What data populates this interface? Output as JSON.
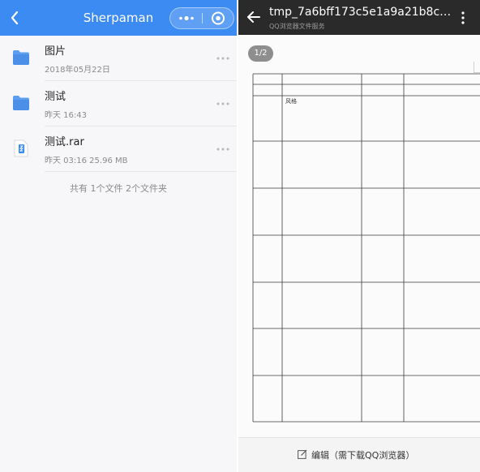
{
  "mini_program": {
    "title": "Sherpaman",
    "header_color": "#3c8bf2",
    "back_icon": "chevron-left-icon",
    "capsule": {
      "more_icon": "more-dots-icon",
      "close_icon": "target-close-icon"
    },
    "files": [
      {
        "name": "图片",
        "meta": "2018年05月22日",
        "icon": "folder-icon"
      },
      {
        "name": "测试",
        "meta": "昨天 16:43",
        "icon": "folder-icon"
      },
      {
        "name": "测试.rar",
        "meta": "昨天 03:16 25.96 MB",
        "icon": "archive-file-icon"
      }
    ],
    "summary": "共有 1个文件 2个文件夹"
  },
  "browser": {
    "title": "tmp_7a6bff173c5e1a9a21b8ce...",
    "subtitle": "QQ浏览器文件服务",
    "back_icon": "arrow-left-icon",
    "menu_icon": "vertical-dots-icon",
    "page_indicator": "1/2",
    "document_cell_text": "风格",
    "edit_label": "编辑（需下载QQ浏览器）",
    "edit_icon": "edit-pencil-icon"
  }
}
